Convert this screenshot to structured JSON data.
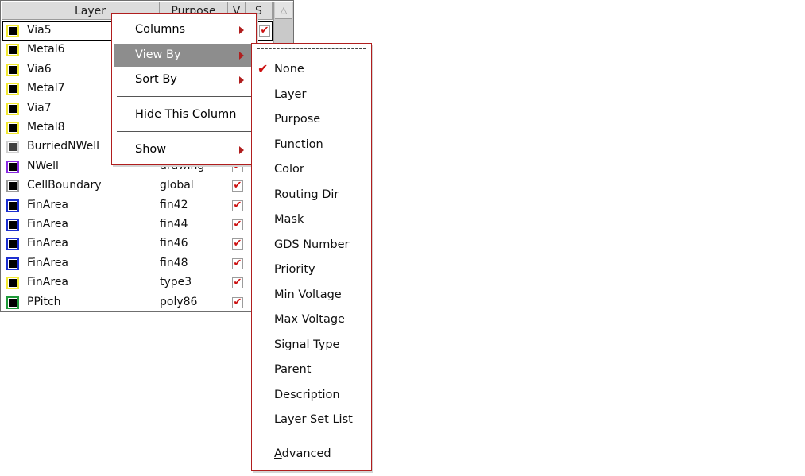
{
  "table": {
    "headers": {
      "layer": "Layer",
      "purpose": "Purpose",
      "v": "V",
      "s": "S"
    },
    "rows": [
      {
        "name": "Via5",
        "purpose": "",
        "swatch": "#f2e830",
        "fill": "#000000",
        "selected": true
      },
      {
        "name": "Metal6",
        "purpose": "",
        "swatch": "#f2e830",
        "fill": "#000000"
      },
      {
        "name": "Via6",
        "purpose": "",
        "swatch": "#f2e830",
        "fill": "#000000"
      },
      {
        "name": "Metal7",
        "purpose": "",
        "swatch": "#f2e830",
        "fill": "#000000"
      },
      {
        "name": "Via7",
        "purpose": "",
        "swatch": "#f2e830",
        "fill": "#000000"
      },
      {
        "name": "Metal8",
        "purpose": "",
        "swatch": "#f2e830",
        "fill": "#000000"
      },
      {
        "name": "BurriedNWell",
        "purpose": "",
        "swatch": "#d0d0d0",
        "fill": "#404040"
      },
      {
        "name": "NWell",
        "purpose": "drawing",
        "swatch": "#8a2be2",
        "fill": "#000000"
      },
      {
        "name": "CellBoundary",
        "purpose": "global",
        "swatch": "#9a9a9a",
        "fill": "#000000"
      },
      {
        "name": "FinArea",
        "purpose": "fin42",
        "swatch": "#1c2fd0",
        "fill": "#000000"
      },
      {
        "name": "FinArea",
        "purpose": "fin44",
        "swatch": "#1c2fd0",
        "fill": "#000000"
      },
      {
        "name": "FinArea",
        "purpose": "fin46",
        "swatch": "#1c2fd0",
        "fill": "#000000"
      },
      {
        "name": "FinArea",
        "purpose": "fin48",
        "swatch": "#1c2fd0",
        "fill": "#000000"
      },
      {
        "name": "FinArea",
        "purpose": "type3",
        "swatch": "#f2e830",
        "fill": "#000000"
      },
      {
        "name": "PPitch",
        "purpose": "poly86",
        "swatch": "#1f9a3a",
        "fill": "#000000"
      }
    ]
  },
  "context_menu": {
    "items": [
      {
        "label": "Columns",
        "submenu": true
      },
      {
        "label": "View By",
        "submenu": true,
        "highlighted": true
      },
      {
        "label": "Sort By",
        "submenu": true
      },
      {
        "label": "Hide This Column",
        "submenu": false
      },
      {
        "label": "Show",
        "submenu": true
      }
    ]
  },
  "view_by_menu": {
    "items": [
      {
        "label": "None",
        "checked": true
      },
      {
        "label": "Layer"
      },
      {
        "label": "Purpose"
      },
      {
        "label": "Function"
      },
      {
        "label": "Color"
      },
      {
        "label": "Routing Dir"
      },
      {
        "label": "Mask"
      },
      {
        "label": "GDS Number"
      },
      {
        "label": "Priority"
      },
      {
        "label": "Min Voltage"
      },
      {
        "label": "Max Voltage"
      },
      {
        "label": "Signal Type"
      },
      {
        "label": "Parent"
      },
      {
        "label": "Description"
      },
      {
        "label": "Layer Set List"
      }
    ],
    "advanced": {
      "mnemonic": "A",
      "rest": "dvanced"
    }
  },
  "colors": {
    "accent": "#cc1111",
    "menu_border": "#b01e1e",
    "highlight": "#8d8d8d"
  },
  "icons": {
    "check": "✔",
    "scroll_up": "△"
  }
}
